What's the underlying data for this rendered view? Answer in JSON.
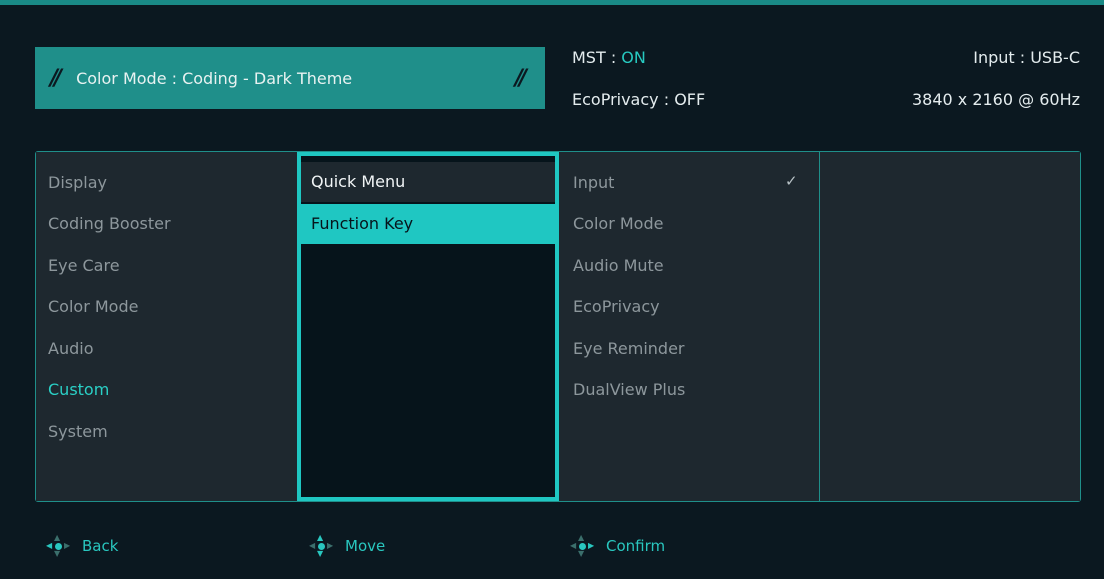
{
  "header": {
    "color_mode_label": "Color Mode : Coding - Dark Theme",
    "mst_label": "MST : ",
    "mst_value": "ON",
    "ecoprivacy_label": "EcoPrivacy : OFF",
    "input_label": "Input : USB-C",
    "resolution_label": "3840 x 2160 @ 60Hz"
  },
  "menu": {
    "main_items": [
      {
        "label": "Display"
      },
      {
        "label": "Coding Booster"
      },
      {
        "label": "Eye Care"
      },
      {
        "label": "Color Mode"
      },
      {
        "label": "Audio"
      },
      {
        "label": "Custom",
        "active": true
      },
      {
        "label": "System"
      }
    ],
    "sub_items": [
      {
        "label": "Quick Menu",
        "state": "focused"
      },
      {
        "label": "Function Key",
        "state": "selected"
      }
    ],
    "options": [
      {
        "label": "Input",
        "checked": true
      },
      {
        "label": "Color Mode"
      },
      {
        "label": "Audio Mute"
      },
      {
        "label": "EcoPrivacy"
      },
      {
        "label": "Eye Reminder"
      },
      {
        "label": "DualView Plus"
      }
    ]
  },
  "footer": {
    "back_label": "Back",
    "move_label": "Move",
    "confirm_label": "Confirm"
  },
  "icons": {
    "check": "check-icon",
    "back": "joystick-left-icon",
    "move": "joystick-updown-icon",
    "confirm": "joystick-press-icon",
    "banner": "double-slash-icon"
  },
  "colors": {
    "accent": "#1fc7c2",
    "banner": "#1f8f8a",
    "active_text": "#2ad0c6"
  }
}
